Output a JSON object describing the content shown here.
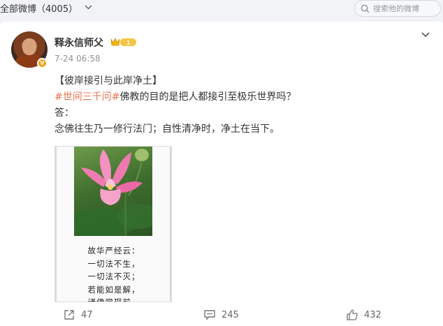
{
  "topbar": {
    "title": "全部微博（4005）",
    "chevron_icon": "chevron-down-icon",
    "search_placeholder": "搜索他的微博"
  },
  "post": {
    "author": "释永信师父",
    "member_level": "1",
    "time": "7-24 06:58",
    "verified_badge": "V",
    "lines": [
      {
        "text": "【彼岸接引与此岸净土】"
      },
      {
        "topic": "#世间三千问#",
        "text": "佛教的目的是把人都接引至极乐世界吗？"
      },
      {
        "text": "答："
      },
      {
        "text": "念佛往生乃一修行法门；自性清净时，净土在当下。"
      }
    ],
    "image_poem": [
      "故华严经云：",
      "一切法不生，",
      "一切法不灭；",
      "若能如是解，",
      "诸佛常现前。"
    ]
  },
  "actions": {
    "share_count": "47",
    "comment_count": "245",
    "like_count": "432"
  },
  "colors": {
    "topic": "#eb7350",
    "background": "#f2f3f5",
    "card": "#ffffff",
    "muted": "#939393"
  }
}
